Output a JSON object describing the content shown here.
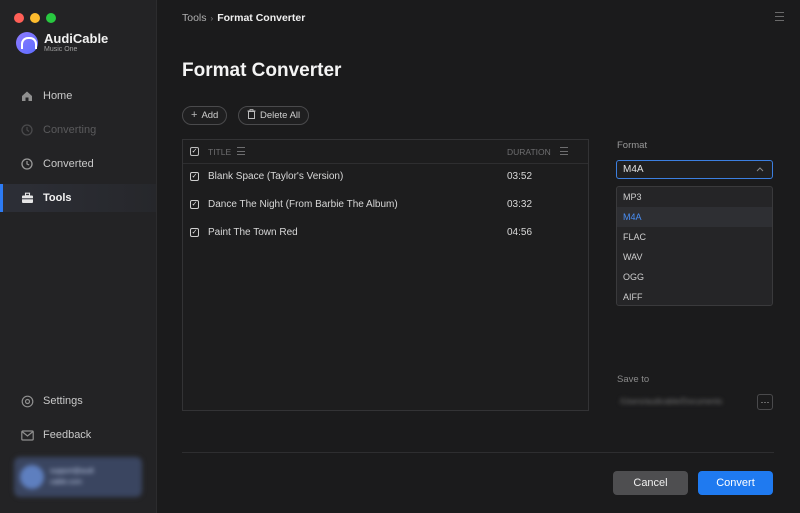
{
  "app": {
    "name": "AudiCable",
    "subtitle": "Music One"
  },
  "sidebar": {
    "items": [
      {
        "label": "Home",
        "icon": "home-icon",
        "state": "normal"
      },
      {
        "label": "Converting",
        "icon": "converting-icon",
        "state": "disabled"
      },
      {
        "label": "Converted",
        "icon": "clock-icon",
        "state": "normal"
      },
      {
        "label": "Tools",
        "icon": "toolbox-icon",
        "state": "active"
      }
    ],
    "bottom": [
      {
        "label": "Settings",
        "icon": "gear-icon"
      },
      {
        "label": "Feedback",
        "icon": "mail-icon"
      }
    ],
    "account": {
      "line1": "support@audi",
      "line2": "cable.com"
    }
  },
  "breadcrumb": {
    "parent": "Tools",
    "separator": "›",
    "current": "Format Converter"
  },
  "main": {
    "title": "Format Converter",
    "add_label": "Add",
    "delete_all_label": "Delete All",
    "table": {
      "columns": {
        "title": "TITLE",
        "duration": "DURATION"
      },
      "rows": [
        {
          "title": "Blank Space (Taylor's Version)",
          "duration": "03:52",
          "checked": true
        },
        {
          "title": "Dance The Night (From Barbie The Album)",
          "duration": "03:32",
          "checked": true
        },
        {
          "title": "Paint The Town Red",
          "duration": "04:56",
          "checked": true
        }
      ]
    }
  },
  "settings": {
    "format_label": "Format",
    "format_selected": "M4A",
    "format_options": [
      "MP3",
      "M4A",
      "FLAC",
      "WAV",
      "OGG",
      "AIFF"
    ],
    "save_to_label": "Save to",
    "save_path": "/Users/audicable/Documents",
    "browse_label": "···"
  },
  "buttons": {
    "cancel": "Cancel",
    "convert": "Convert"
  },
  "colors": {
    "accent": "#1f7af0",
    "active_option": "#4a8ff5",
    "background": "#1b1b1c",
    "sidebar": "#232325"
  }
}
